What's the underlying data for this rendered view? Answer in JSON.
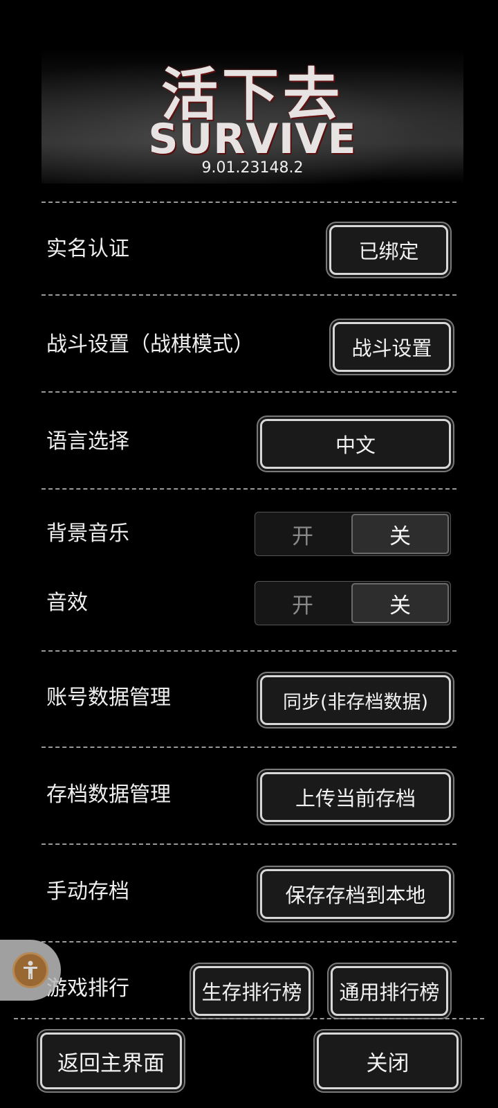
{
  "header": {
    "logo_cn": "活下去",
    "logo_en": "SURVIVE",
    "version": "9.01.23148.2"
  },
  "settings": {
    "realname": {
      "label": "实名认证",
      "button": "已绑定"
    },
    "battle": {
      "label": "战斗设置（战棋模式）",
      "button": "战斗设置"
    },
    "language": {
      "label": "语言选择",
      "button": "中文"
    },
    "bgm": {
      "label": "背景音乐",
      "on": "开",
      "off": "关",
      "selected": "关"
    },
    "sfx": {
      "label": "音效",
      "on": "开",
      "off": "关",
      "selected": "关"
    },
    "account": {
      "label": "账号数据管理",
      "button": "同步(非存档数据)"
    },
    "save_data": {
      "label": "存档数据管理",
      "button": "上传当前存档"
    },
    "manual_save": {
      "label": "手动存档",
      "button": "保存存档到本地"
    },
    "ranking": {
      "label": "游戏排行",
      "button_survival": "生存排行榜",
      "button_general": "通用排行榜"
    }
  },
  "footer": {
    "back_button": "返回主界面",
    "close_button": "关闭"
  },
  "icons": {
    "assist": "accessibility-icon"
  }
}
